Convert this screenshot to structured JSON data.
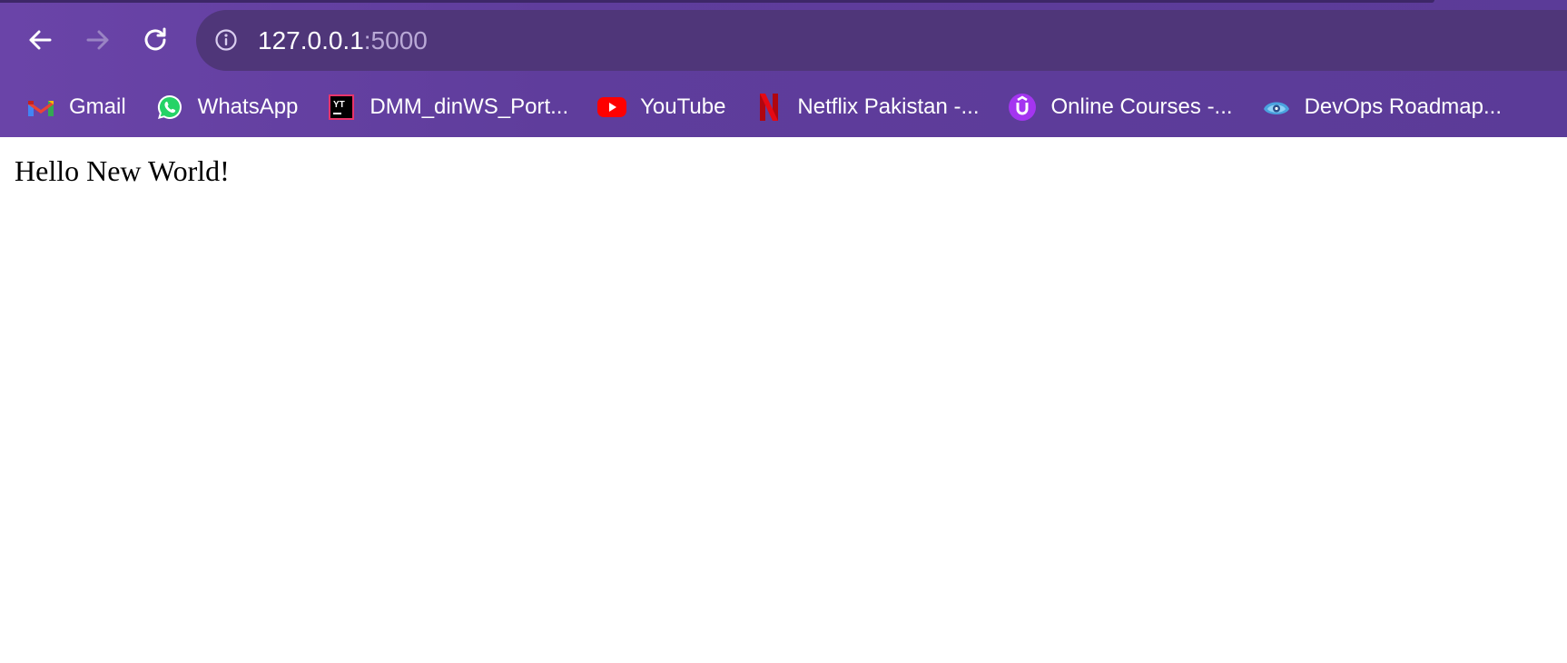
{
  "browser": {
    "address_bar": {
      "host": "127.0.0.1",
      "port": ":5000"
    },
    "bookmarks": [
      {
        "label": "Gmail",
        "icon": "gmail-icon"
      },
      {
        "label": "WhatsApp",
        "icon": "whatsapp-icon"
      },
      {
        "label": "DMM_dinWS_Port...",
        "icon": "jetbrains-yt-icon"
      },
      {
        "label": "YouTube",
        "icon": "youtube-icon"
      },
      {
        "label": "Netflix Pakistan -...",
        "icon": "netflix-icon"
      },
      {
        "label": "Online Courses -...",
        "icon": "udemy-icon"
      },
      {
        "label": "DevOps Roadmap...",
        "icon": "roadmap-eye-icon"
      }
    ],
    "colors": {
      "chrome_bg": "#6a44a8",
      "omnibox_bg": "#4f3679"
    }
  },
  "page": {
    "text": "Hello New World!"
  }
}
